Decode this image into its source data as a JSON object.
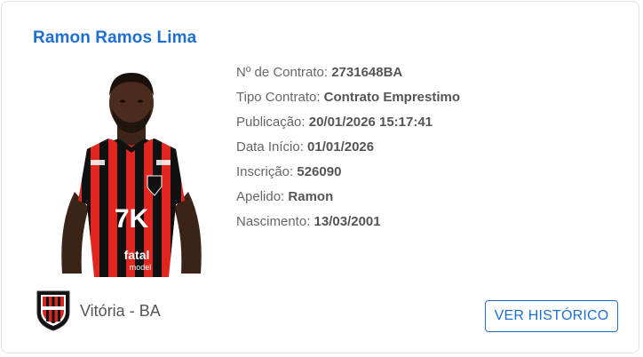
{
  "player": {
    "name": "Ramon Ramos Lima"
  },
  "details": [
    {
      "label": "Nº de Contrato:",
      "value": "2731648BA"
    },
    {
      "label": "Tipo Contrato:",
      "value": "Contrato Emprestimo"
    },
    {
      "label": "Publicação:",
      "value": "20/01/2026 15:17:41"
    },
    {
      "label": "Data Início:",
      "value": "01/01/2026"
    },
    {
      "label": "Inscrição:",
      "value": "526090"
    },
    {
      "label": "Apelido:",
      "value": "Ramon"
    },
    {
      "label": "Nascimento:",
      "value": "13/03/2001"
    }
  ],
  "club": {
    "name": "Vitória - BA",
    "badge_icon": "club-crest-icon"
  },
  "photo": {
    "icon": "player-photo",
    "sponsor_chest": "7K",
    "sponsor_bottom": "fatal",
    "sponsor_bottom_sub": "model"
  },
  "actions": {
    "history_label": "VER HISTÓRICO"
  },
  "colors": {
    "accent": "#1e6fd1",
    "jersey_red": "#e0271f",
    "jersey_black": "#111111"
  }
}
